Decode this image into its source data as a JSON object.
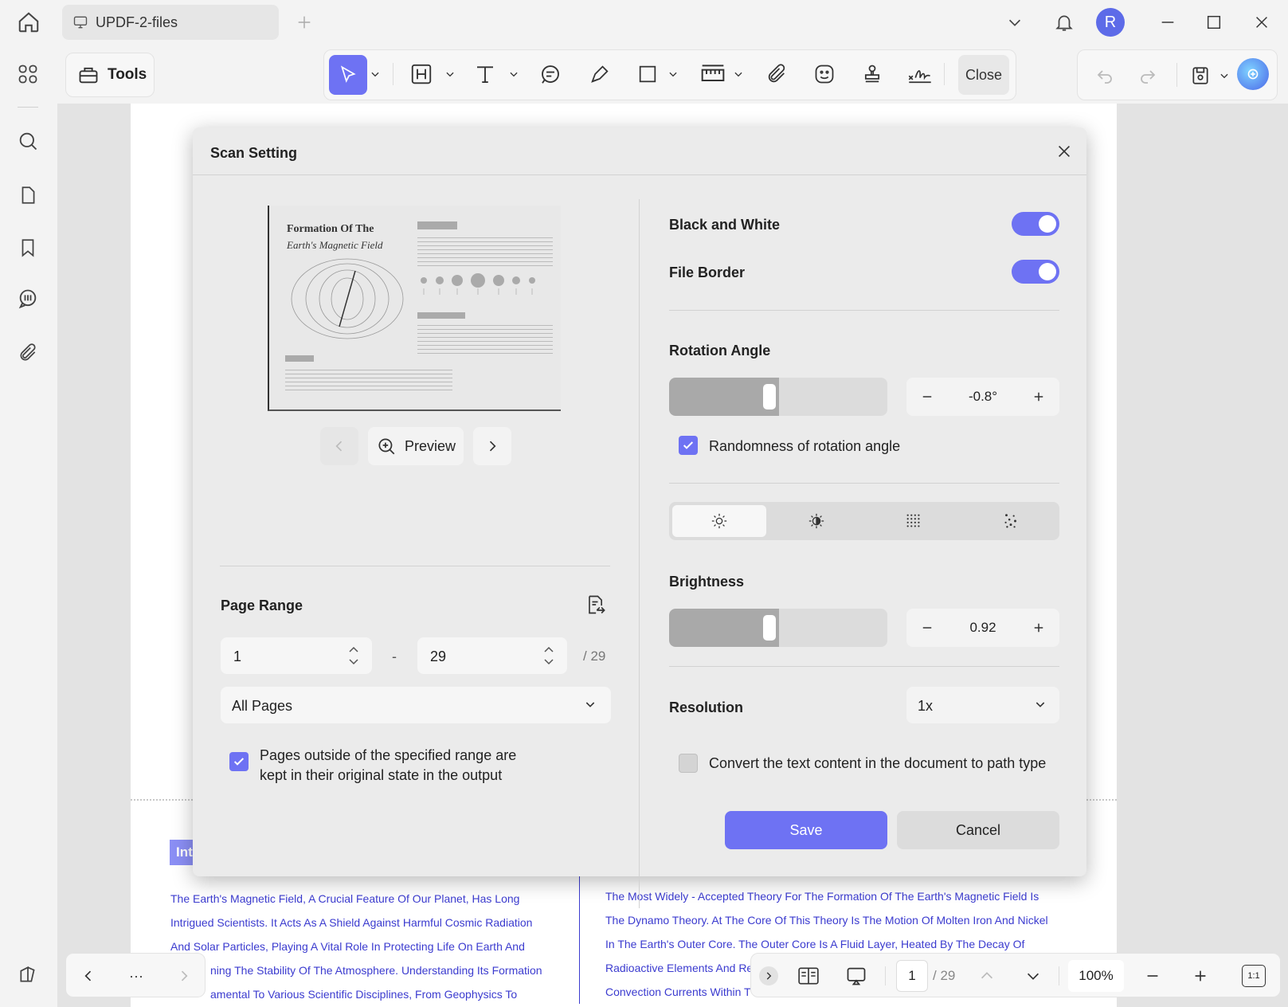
{
  "window": {
    "tab_title": "UPDF-2-files",
    "avatar_letter": "R"
  },
  "toolbar": {
    "tools_label": "Tools",
    "close_label": "Close"
  },
  "dialog": {
    "title": "Scan Setting",
    "preview": {
      "doc_title_line1": "Formation Of The",
      "doc_title_line2": "Earth's Magnetic Field",
      "preview_label": "Preview"
    },
    "page_range": {
      "label": "Page Range",
      "from": "1",
      "dash": "-",
      "to": "29",
      "total": "/ 29",
      "select_value": "All Pages",
      "keep_outside_label_line1": "Pages outside of the specified range are",
      "keep_outside_label_line2": "kept in their original state in the output",
      "keep_outside_checked": true
    },
    "black_white": {
      "label": "Black and White",
      "on": true
    },
    "file_border": {
      "label": "File Border",
      "on": true
    },
    "rotation": {
      "label": "Rotation Angle",
      "value": "-0.8°",
      "slider_fraction": 0.5,
      "randomness_label": "Randomness of rotation angle",
      "randomness_checked": true
    },
    "adjust_tabs": [
      "brightness-icon",
      "contrast-icon",
      "noise-icon",
      "dots-icon"
    ],
    "brightness": {
      "label": "Brightness",
      "value": "0.92",
      "slider_fraction": 0.5
    },
    "resolution": {
      "label": "Resolution",
      "value": "1x"
    },
    "convert_text": {
      "label": "Convert the text content in the document to path type",
      "checked": false
    },
    "save_label": "Save",
    "cancel_label": "Cancel"
  },
  "document": {
    "heading_fragment": "Int",
    "left_lines": [
      "The Earth's Magnetic Field, A Crucial Feature Of Our Planet, Has Long",
      "Intrigued Scientists. It Acts As A Shield Against Harmful Cosmic Radiation",
      "And Solar Particles, Playing A Vital Role In Protecting Life On Earth And",
      "ning The Stability Of The Atmosphere. Understanding Its Formation",
      "amental To Various Scientific Disciplines, From Geophysics To"
    ],
    "right_lines": [
      "The Most Widely - Accepted Theory For The Formation Of The Earth's Magnetic Field Is",
      "The Dynamo Theory. At The Core Of This Theory Is The Motion Of Molten Iron And Nickel",
      "In The Earth's Outer Core. The Outer Core Is A Fluid Layer, Heated By The Decay Of",
      "Radioactive Elements And Re",
      "Convection Currents Within T"
    ]
  },
  "bottom_nav": {
    "more": "···"
  },
  "page_nav": {
    "current": "1",
    "total": "/ 29",
    "zoom": "100%",
    "fit_label": "1:1"
  },
  "colors": {
    "accent": "#6e72f3",
    "doc_text": "#3b3bcf"
  }
}
